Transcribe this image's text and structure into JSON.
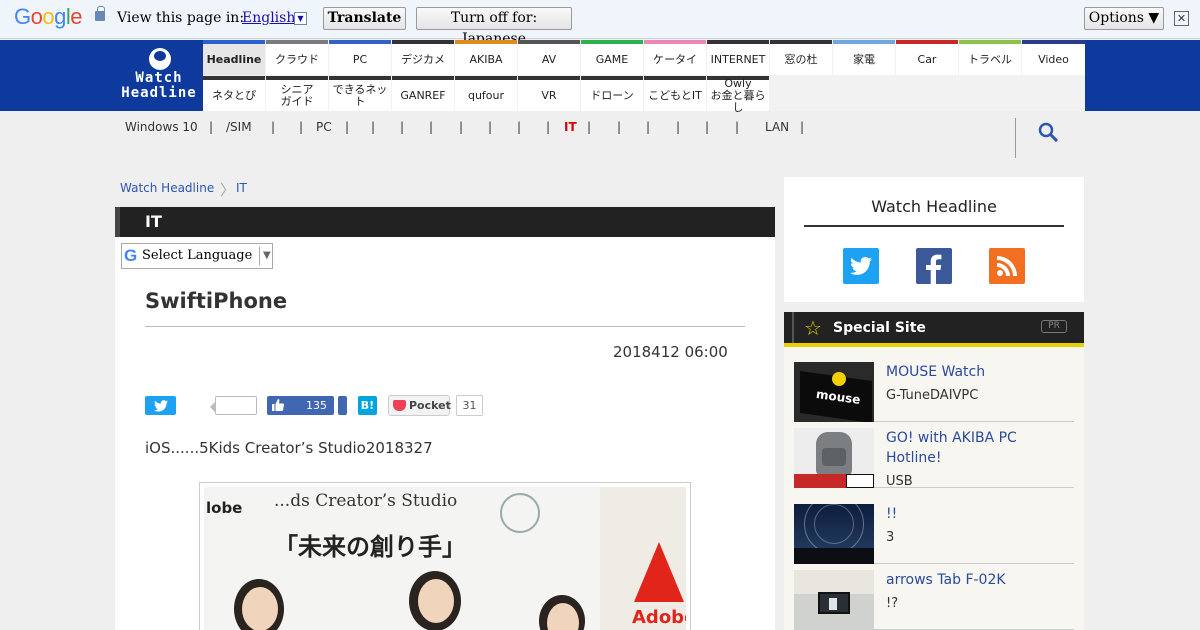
{
  "translate_bar": {
    "brand": "Google",
    "view_label": "View this page in:",
    "language": "English",
    "translate_btn": "Translate",
    "turn_off_btn": "Turn off for: Japanese",
    "options_btn": "Options ▼",
    "close": "✕"
  },
  "logo": {
    "line1": "Watch",
    "line2": "Headline"
  },
  "nav": {
    "row1": [
      "Headline",
      "クラウド",
      "PC",
      "デジカメ",
      "AKIBA",
      "AV",
      "GAME",
      "ケータイ",
      "INTERNET",
      "窓の杜",
      "家電",
      "Car",
      "トラベル",
      "Video"
    ],
    "row2": [
      "ネタとぴ",
      "シニアガイド",
      "できるネット",
      "GANREF",
      "qufour",
      "VR",
      "ドローン",
      "こどもとIT",
      "Owlyお金と暮らし"
    ],
    "row1_colors": [
      "#2a62c9",
      "#7a7a7a",
      "#3361c8",
      "#333333",
      "#e08a1e",
      "#555555",
      "#2bb24c",
      "#e889b4",
      "#333333",
      "#333333",
      "#6fa8dc",
      "#c62828",
      "#8bc34a",
      "#2a3a8c"
    ]
  },
  "subnav": {
    "items": [
      "Windows 10",
      "|",
      "/SIM",
      "|",
      "|",
      "PC",
      "|",
      "|",
      "|",
      "|",
      "|",
      "|",
      "|",
      "|",
      "IT",
      "|",
      "|",
      "|",
      "|",
      "|",
      "|",
      "LAN",
      "|"
    ]
  },
  "breadcrumb": {
    "home": "Watch Headline",
    "sep": "〉",
    "current": "IT"
  },
  "article": {
    "category": "IT",
    "select_language": "Select Language",
    "select_arrow": "▼",
    "title": "SwiftiPhone",
    "date": "2018412 06:00",
    "fb_count": "135",
    "hatena": "B!",
    "pocket_label": "Pocket",
    "pocket_count": "31",
    "lead": "iOS......5Kids Creator’s Studio2018327",
    "photo": {
      "banner": "...ds Creator’s Studio",
      "big": "「未来の創り手」",
      "lobe": "lobe",
      "adobe": "Adobe"
    }
  },
  "sidebar": {
    "follow_title": "Watch Headline",
    "special_title": "Special Site",
    "pr": "PR",
    "items": [
      {
        "name": "MOUSE Watch",
        "sub": "G-TuneDAIVPC"
      },
      {
        "name": "GO! with AKIBA PC Hotline!",
        "sub": "USB"
      },
      {
        "name": "!!",
        "sub": "3"
      },
      {
        "name": "arrows Tab F-02K",
        "sub": "!?"
      }
    ]
  }
}
